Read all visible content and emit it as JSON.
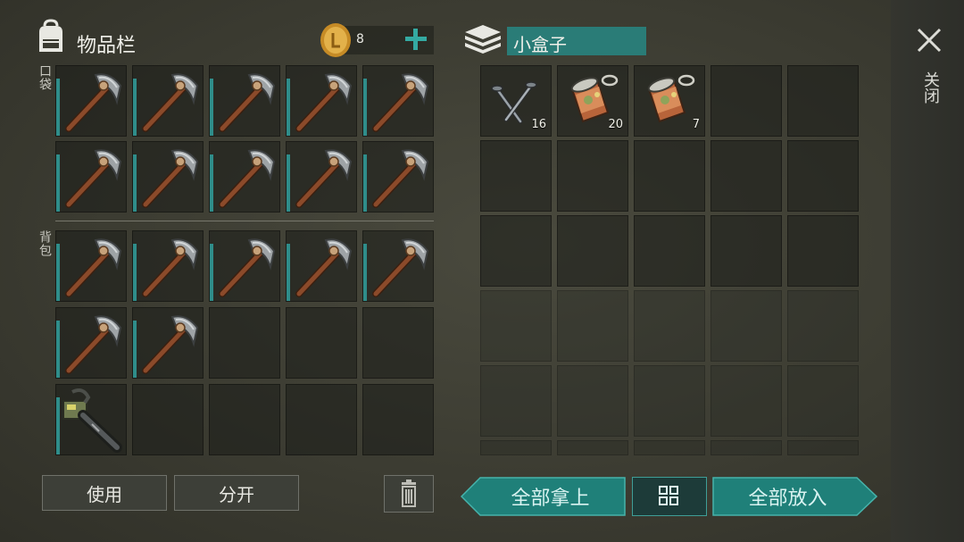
{
  "inventory": {
    "title": "物品栏",
    "pocket_label": "口袋",
    "backpack_label": "背包",
    "coins": "8",
    "add_label": "+"
  },
  "container": {
    "name": "小盒子",
    "items": [
      {
        "icon": "nails-icon",
        "count": "16"
      },
      {
        "icon": "canned-food-icon",
        "count": "20"
      },
      {
        "icon": "canned-food-icon",
        "count": "7"
      }
    ]
  },
  "close": {
    "label": "关闭"
  },
  "buttons": {
    "use": "使用",
    "split": "分开",
    "take_all": "全部拿上",
    "put_all": "全部放入"
  },
  "colors": {
    "accent": "#2f8d8a",
    "button_teal": "#1f8079",
    "coin": "#d9a43a"
  }
}
